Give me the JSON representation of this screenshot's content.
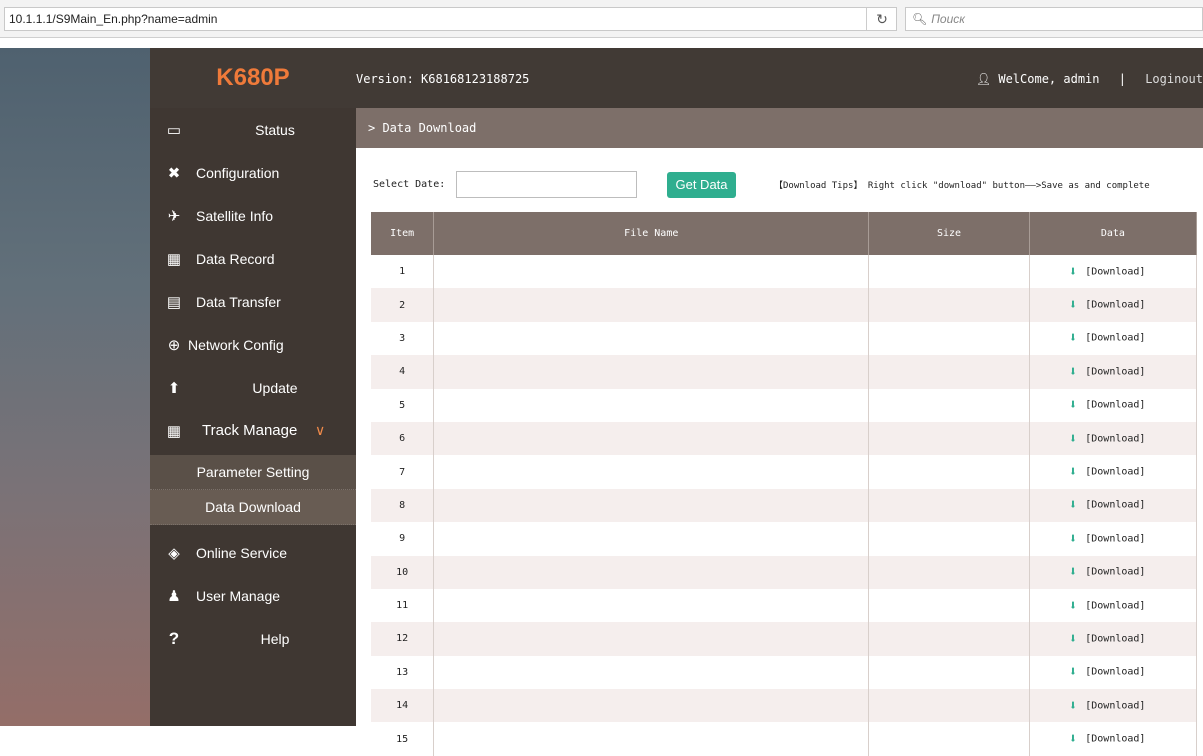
{
  "browser": {
    "url": "10.1.1.1/S9Main_En.php?name=admin",
    "search_placeholder": "Поиск",
    "reload_icon": "reload-icon"
  },
  "header": {
    "logo": "K680P",
    "version": "Version: K68168123188725",
    "welcome": "WelCome, admin",
    "separator": "|",
    "logout": "Loginout",
    "accent": "#ef7a3a"
  },
  "sidebar": {
    "items": [
      {
        "label": "Status",
        "icon": "monitor-icon"
      },
      {
        "label": "Configuration",
        "icon": "tools-icon"
      },
      {
        "label": "Satellite Info",
        "icon": "satellite-icon"
      },
      {
        "label": "Data Record",
        "icon": "calendar-icon"
      },
      {
        "label": "Data Transfer",
        "icon": "network-device-icon"
      },
      {
        "label": "Network Config",
        "icon": "globe-icon"
      },
      {
        "label": "Update",
        "icon": "upload-icon"
      },
      {
        "label": "Track Manage",
        "icon": "calendar-icon"
      },
      {
        "label": "Online Service",
        "icon": "cube-icon"
      },
      {
        "label": "User Manage",
        "icon": "user-group-icon"
      },
      {
        "label": "Help",
        "icon": "question-icon"
      }
    ],
    "sub_items": [
      {
        "label": "Parameter Setting"
      },
      {
        "label": "Data Download"
      }
    ]
  },
  "content": {
    "breadcrumb": "> Data Download",
    "select_date_label": "Select Date:",
    "date_value": "",
    "get_data_label": "Get Data",
    "tips": "【Download Tips】 Right click \"download\" button——>Save as and complete",
    "button_color": "#2fae8f"
  },
  "table": {
    "headers": [
      "Item",
      "File Name",
      "Size",
      "Data"
    ],
    "download_label": "[Download]",
    "rows": [
      {
        "item": "1",
        "file_name": "",
        "size": ""
      },
      {
        "item": "2",
        "file_name": "",
        "size": ""
      },
      {
        "item": "3",
        "file_name": "",
        "size": ""
      },
      {
        "item": "4",
        "file_name": "",
        "size": ""
      },
      {
        "item": "5",
        "file_name": "",
        "size": ""
      },
      {
        "item": "6",
        "file_name": "",
        "size": ""
      },
      {
        "item": "7",
        "file_name": "",
        "size": ""
      },
      {
        "item": "8",
        "file_name": "",
        "size": ""
      },
      {
        "item": "9",
        "file_name": "",
        "size": ""
      },
      {
        "item": "10",
        "file_name": "",
        "size": ""
      },
      {
        "item": "11",
        "file_name": "",
        "size": ""
      },
      {
        "item": "12",
        "file_name": "",
        "size": ""
      },
      {
        "item": "13",
        "file_name": "",
        "size": ""
      },
      {
        "item": "14",
        "file_name": "",
        "size": ""
      },
      {
        "item": "15",
        "file_name": "",
        "size": ""
      }
    ]
  }
}
